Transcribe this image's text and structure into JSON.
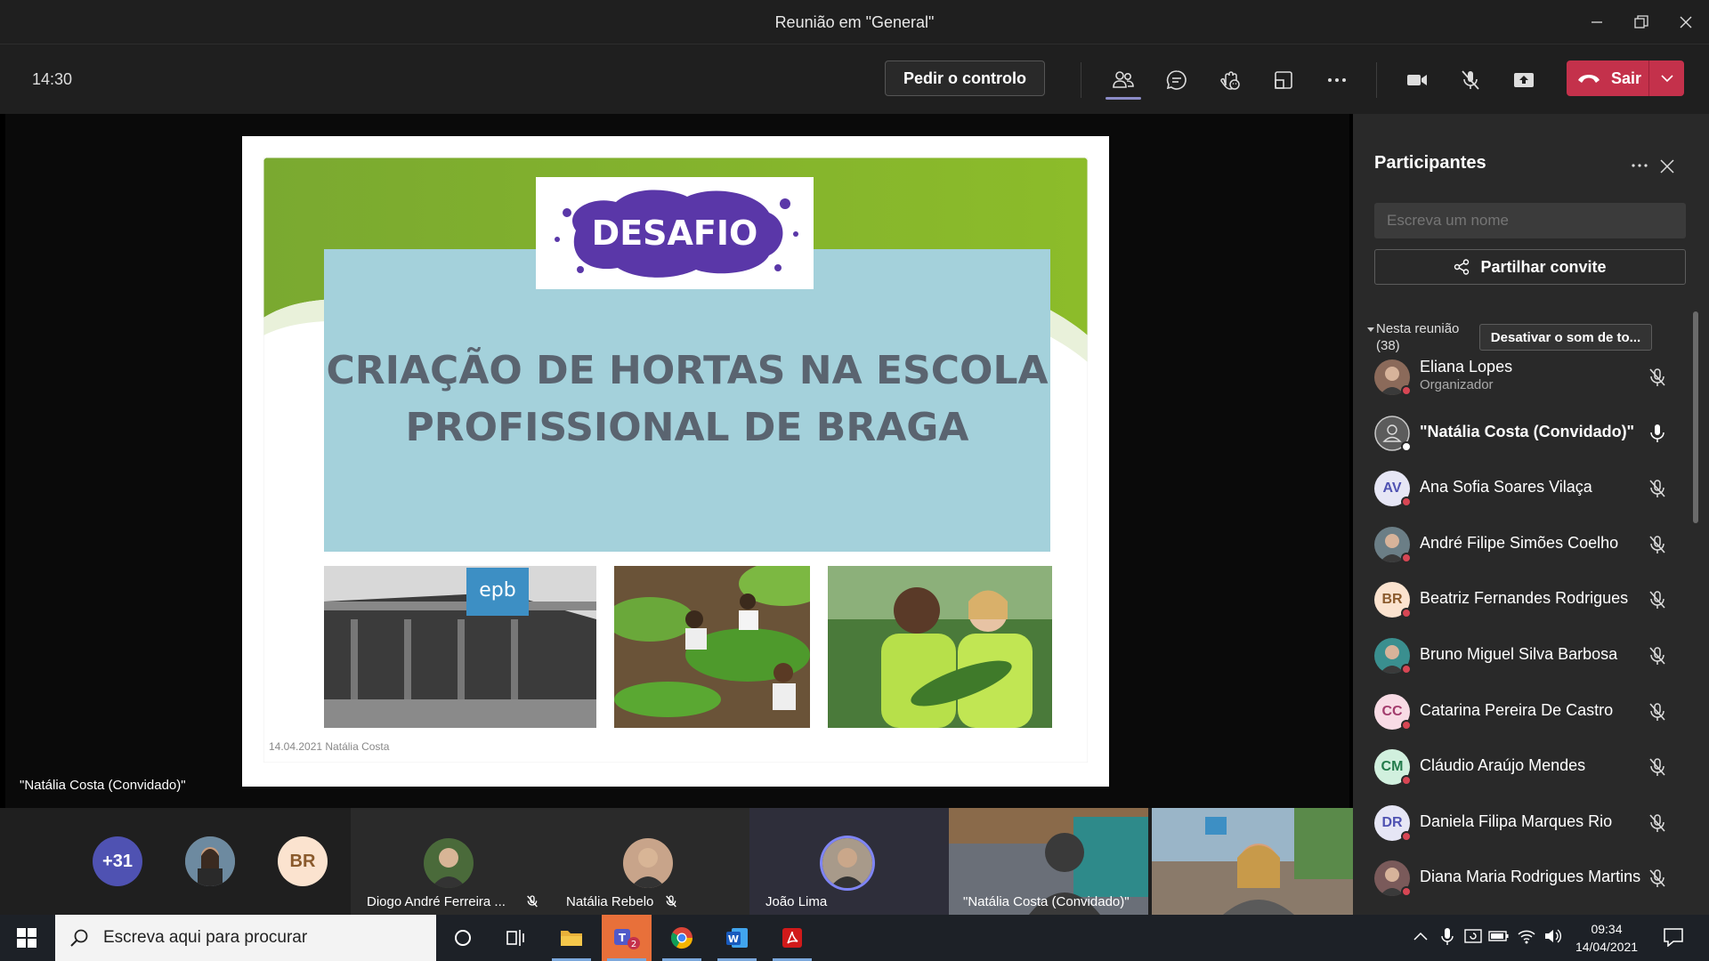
{
  "window": {
    "title": "Reunião em \"General\""
  },
  "toolbar": {
    "time": "14:30",
    "request_control": "Pedir o controlo",
    "leave_label": "Sair",
    "colors": {
      "leave": "#c4314b",
      "active": "#8b8cc7"
    }
  },
  "slide": {
    "badge": "DESAFIO",
    "title_line1": "CRIAÇÃO DE HORTAS NA ESCOLA",
    "title_line2": "PROFISSIONAL DE BRAGA",
    "photo1_sign": "epb",
    "footer": "14.04.2021 Natália Costa"
  },
  "stage": {
    "speaker_label": "\"Natália Costa (Convidado)\""
  },
  "panel": {
    "title": "Participantes",
    "search_placeholder": "Escreva um nome",
    "share_label": "Partilhar convite",
    "section_label": "Nesta reunião",
    "section_count": "(38)",
    "mute_all": "Desativar o som de to...",
    "participants": [
      {
        "name": "Eliana Lopes",
        "role": "Organizador",
        "initials": "",
        "avatar_color": "#8b6a5a",
        "photo": true,
        "mic": "muted"
      },
      {
        "name": "\"Natália Costa (Convidado)\"",
        "role": "",
        "initials": "",
        "avatar_color": "#5a5a5a",
        "photo": false,
        "mic": "on",
        "bold": true
      },
      {
        "name": "Ana Sofia Soares Vilaça",
        "role": "",
        "initials": "AV",
        "avatar_color": "#e6e6f5",
        "text_color": "#4f52b2",
        "mic": "muted"
      },
      {
        "name": "André Filipe Simões Coelho",
        "role": "",
        "initials": "",
        "avatar_color": "#6b7e86",
        "photo": true,
        "mic": "muted"
      },
      {
        "name": "Beatriz Fernandes Rodrigues",
        "role": "",
        "initials": "BR",
        "avatar_color": "#fbe3cf",
        "text_color": "#8a5a2c",
        "mic": "muted"
      },
      {
        "name": "Bruno Miguel Silva Barbosa",
        "role": "",
        "initials": "",
        "avatar_color": "#3a8f8f",
        "photo": true,
        "mic": "muted"
      },
      {
        "name": "Catarina Pereira De Castro",
        "role": "",
        "initials": "CC",
        "avatar_color": "#f8dbe5",
        "text_color": "#a33c6d",
        "mic": "muted"
      },
      {
        "name": "Cláudio Araújo Mendes",
        "role": "",
        "initials": "CM",
        "avatar_color": "#d1f0de",
        "text_color": "#237b4b",
        "mic": "muted"
      },
      {
        "name": "Daniela Filipa Marques Rio",
        "role": "",
        "initials": "DR",
        "avatar_color": "#e6e6f5",
        "text_color": "#4f52b2",
        "mic": "muted"
      },
      {
        "name": "Diana Maria Rodrigues Martins",
        "role": "",
        "initials": "",
        "avatar_color": "#7a5a5a",
        "photo": true,
        "mic": "muted"
      }
    ]
  },
  "strip": {
    "overflow": "+31",
    "br_initials": "BR",
    "tiles": [
      {
        "name": "Diogo André Ferreira ...",
        "mic": "muted"
      },
      {
        "name": "Natália Rebelo",
        "mic": "muted"
      },
      {
        "name": "João Lima",
        "mic": "none"
      },
      {
        "name": "\"Natália Costa (Convidado)\"",
        "mic": "none"
      }
    ]
  },
  "taskbar": {
    "search_placeholder": "Escreva aqui para procurar",
    "teams_badge": "2",
    "time": "09:34",
    "date": "14/04/2021"
  }
}
